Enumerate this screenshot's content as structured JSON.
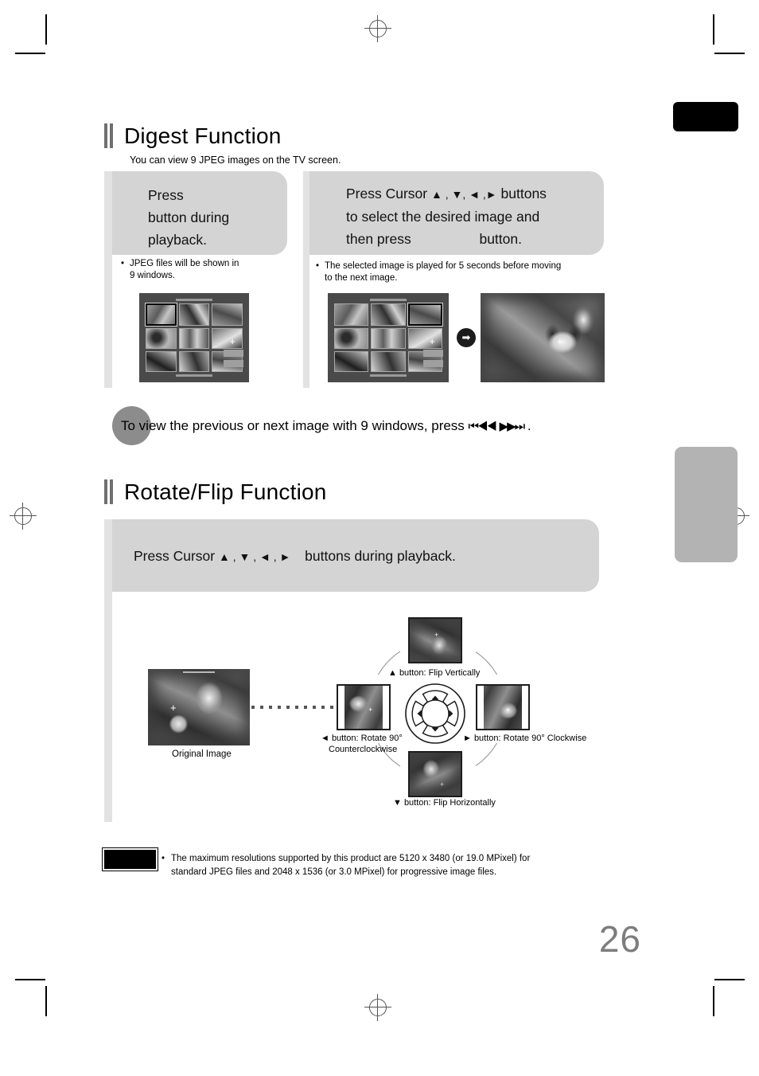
{
  "page": {
    "number": "26"
  },
  "sections": [
    {
      "title": "Digest Function",
      "subtitle": "You can view 9 JPEG images on the TV screen."
    },
    {
      "title": "Rotate/Flip Function"
    }
  ],
  "digest": {
    "step1": {
      "callout": "Press\nbutton during\nplayback.",
      "callout_line1": "Press",
      "callout_line2": "button during",
      "callout_line3": "playback.",
      "bullet": "JPEG files will be shown in 9 windows.",
      "bullet_line1": "JPEG files will be shown in",
      "bullet_line2": "9 windows.",
      "bullet_marker": "•"
    },
    "step2": {
      "callout_line1_a": "Press Cursor",
      "callout_line1_icons": "▲ , ▼, ◄ ,►",
      "callout_line1_b": "buttons",
      "callout_line2": "to select the desired image and",
      "callout_line3_a": "then press",
      "callout_line3_b": "button.",
      "bullet_line1": "The selected image is played for 5 seconds before moving",
      "bullet_line2": "to the next image.",
      "bullet_marker": "•",
      "transition_icon": "➡"
    },
    "note": {
      "text_a": "To view the previous or next image with 9 windows, press",
      "icon_prev": "⏮◀◀",
      "icon_next": "▶▶⏭",
      "text_b": "."
    }
  },
  "rotate": {
    "callout_a": "Press Cursor",
    "callout_icons": "▲ , ▼ , ◄ , ►",
    "callout_b": "buttons during playback.",
    "original_label": "Original Image",
    "captions": {
      "up": "▲ button: Flip Vertically",
      "down": "▼ button: Flip Horizontally",
      "left_line1": "◄ button: Rotate 90°",
      "left_line2": "Counterclockwise",
      "right": "► button: Rotate 90° Clockwise"
    }
  },
  "bottom_note": {
    "marker": "•",
    "line1": "The maximum resolutions supported by this product are 5120 x 3480 (or 19.0 MPixel) for",
    "line2": "standard JPEG files and 2048 x 1536 (or 3.0 MPixel) for progressive image files."
  },
  "colors": {
    "callout_bg": "#d4d4d4",
    "rail": "#e2e2e2",
    "heading_bar": "#6f6f6f",
    "tab_black": "#000000",
    "tab_gray": "#b3b3b3",
    "page_number": "#7d7d7d",
    "badge": "#8c8c8c"
  }
}
